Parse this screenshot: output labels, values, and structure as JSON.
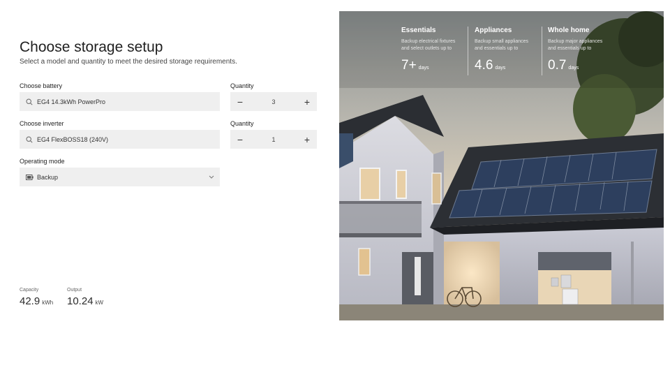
{
  "page": {
    "title": "Choose storage setup",
    "subtitle": "Select a model and quantity to meet the desired storage requirements."
  },
  "battery": {
    "label": "Choose battery",
    "value": "EG4 14.3kWh PowerPro",
    "quantity_label": "Quantity",
    "quantity": "3"
  },
  "inverter": {
    "label": "Choose inverter",
    "value": "EG4 FlexBOSS18 (240V)",
    "quantity_label": "Quantity",
    "quantity": "1"
  },
  "mode": {
    "label": "Operating mode",
    "value": "Backup"
  },
  "stepper": {
    "minus": "−",
    "plus": "+"
  },
  "stats": {
    "capacity_label": "Capacity",
    "capacity_value": "42.9",
    "capacity_unit": "kWh",
    "output_label": "Output",
    "output_value": "10.24",
    "output_unit": "kW"
  },
  "overlay": [
    {
      "heading": "Essentials",
      "line1": "Backup electrical fixtures",
      "line2": "and select outlets up to",
      "value": "7+",
      "unit": "days"
    },
    {
      "heading": "Appliances",
      "line1": "Backup small appliances",
      "line2": "and essentials up to",
      "value": "4.6",
      "unit": "days"
    },
    {
      "heading": "Whole home",
      "line1": "Backup major appliances",
      "line2": "and essentials up to",
      "value": "0.7",
      "unit": "days"
    }
  ],
  "icons": {
    "search": "search-icon",
    "battery": "battery-icon",
    "chevron": "chevron-down-icon"
  }
}
